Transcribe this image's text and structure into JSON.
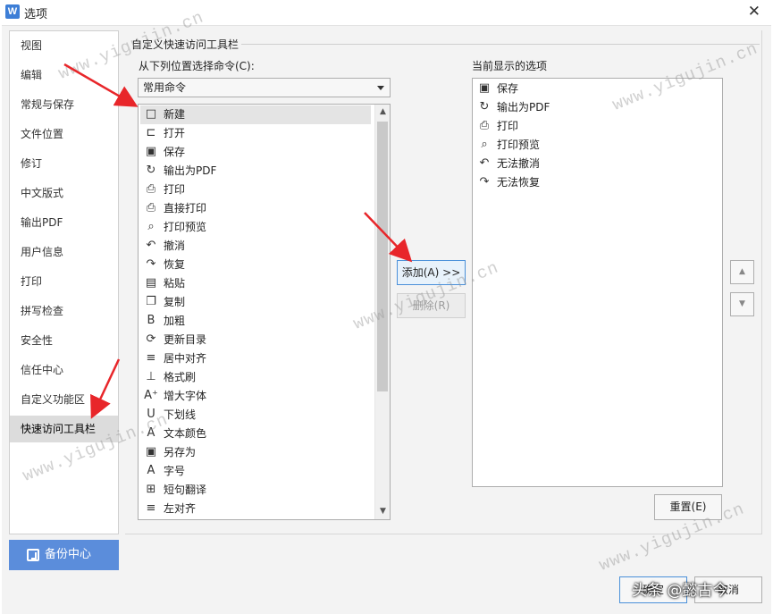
{
  "window": {
    "title": "选项",
    "app_icon_letter": "W",
    "close_glyph": "✕"
  },
  "nav": {
    "items": [
      {
        "label": "视图"
      },
      {
        "label": "编辑"
      },
      {
        "label": "常规与保存"
      },
      {
        "label": "文件位置"
      },
      {
        "label": "修订"
      },
      {
        "label": "中文版式"
      },
      {
        "label": "输出PDF"
      },
      {
        "label": "用户信息"
      },
      {
        "label": "打印"
      },
      {
        "label": "拼写检查"
      },
      {
        "label": "安全性"
      },
      {
        "label": "信任中心"
      },
      {
        "label": "自定义功能区"
      },
      {
        "label": "快速访问工具栏"
      }
    ],
    "active_index": 13
  },
  "backup": {
    "label": "备份中心"
  },
  "panel": {
    "section_title": "自定义快速访问工具栏",
    "from_label": "从下列位置选择命令(C):",
    "current_label": "当前显示的选项",
    "select_value": "常用命令"
  },
  "commands": [
    {
      "label": "新建",
      "icon": "new-doc-icon",
      "glyph": "□"
    },
    {
      "label": "打开",
      "icon": "folder-open-icon",
      "glyph": "⊏"
    },
    {
      "label": "保存",
      "icon": "save-icon",
      "glyph": "▣"
    },
    {
      "label": "输出为PDF",
      "icon": "export-pdf-icon",
      "glyph": "↻"
    },
    {
      "label": "打印",
      "icon": "printer-icon",
      "glyph": "⎙"
    },
    {
      "label": "直接打印",
      "icon": "quick-print-icon",
      "glyph": "⎙"
    },
    {
      "label": "打印预览",
      "icon": "print-preview-icon",
      "glyph": "⌕"
    },
    {
      "label": "撤消",
      "icon": "undo-icon",
      "glyph": "↶"
    },
    {
      "label": "恢复",
      "icon": "redo-icon",
      "glyph": "↷"
    },
    {
      "label": "粘贴",
      "icon": "paste-icon",
      "glyph": "▤"
    },
    {
      "label": "复制",
      "icon": "copy-icon",
      "glyph": "❐"
    },
    {
      "label": "加粗",
      "icon": "bold-icon",
      "glyph": "B"
    },
    {
      "label": "更新目录",
      "icon": "update-toc-icon",
      "glyph": "⟳"
    },
    {
      "label": "居中对齐",
      "icon": "align-center-icon",
      "glyph": "≡"
    },
    {
      "label": "格式刷",
      "icon": "format-painter-icon",
      "glyph": "⊥"
    },
    {
      "label": "增大字体",
      "icon": "grow-font-icon",
      "glyph": "A⁺"
    },
    {
      "label": "下划线",
      "icon": "underline-icon",
      "glyph": "U"
    },
    {
      "label": "文本颜色",
      "icon": "text-color-icon",
      "glyph": "A"
    },
    {
      "label": "另存为",
      "icon": "save-as-icon",
      "glyph": "▣"
    },
    {
      "label": "字号",
      "icon": "font-size-icon",
      "glyph": "A"
    },
    {
      "label": "短句翻译",
      "icon": "translate-icon",
      "glyph": "⊞"
    },
    {
      "label": "左对齐",
      "icon": "align-left-icon",
      "glyph": "≡"
    }
  ],
  "selected_command_index": 0,
  "current_items": [
    {
      "label": "保存",
      "icon": "save-icon",
      "glyph": "▣"
    },
    {
      "label": "输出为PDF",
      "icon": "export-pdf-icon",
      "glyph": "↻"
    },
    {
      "label": "打印",
      "icon": "printer-icon",
      "glyph": "⎙"
    },
    {
      "label": "打印预览",
      "icon": "print-preview-icon",
      "glyph": "⌕"
    },
    {
      "label": "无法撤消",
      "icon": "undo-icon",
      "glyph": "↶"
    },
    {
      "label": "无法恢复",
      "icon": "redo-icon",
      "glyph": "↷"
    }
  ],
  "buttons": {
    "add": "添加(A) >>",
    "remove": "删除(R)",
    "reset": "重置(E)",
    "ok": "确定",
    "cancel": "取消",
    "move_up_glyph": "▲",
    "move_down_glyph": "▼",
    "scroll_up_glyph": "▲",
    "scroll_down_glyph": "▼"
  },
  "overlay": {
    "text": "头条 @懿古今"
  },
  "watermark": {
    "text": "www.yigujin.cn"
  },
  "colors": {
    "accent": "#5b8ddb",
    "arrow": "#e8262a",
    "primary_border": "#4a90d9"
  }
}
